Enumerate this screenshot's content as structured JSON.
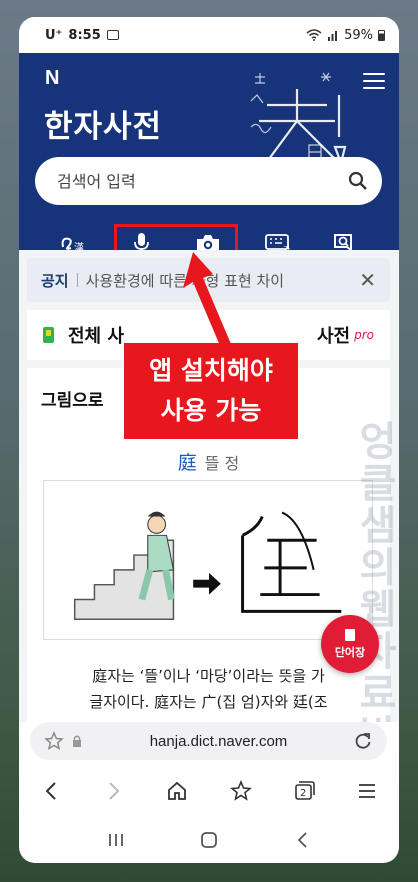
{
  "status_bar": {
    "carrier": "U⁺",
    "time": "8:55",
    "battery": "59%"
  },
  "header": {
    "logo": "N",
    "title": "한자사전",
    "search_placeholder": "검색어 입력"
  },
  "toolbar": {
    "icons": [
      "handwriting-hanja-icon",
      "microphone-icon",
      "camera-icon",
      "hanja-keyboard-icon",
      "dictionary-search-icon"
    ]
  },
  "notice": {
    "tag": "공지",
    "text": "사용환경에 따른 자형 표현 차이"
  },
  "dict_row": {
    "label_left": "전체 사",
    "label_right": "사전",
    "pro": "pro"
  },
  "card": {
    "title": "그림으로",
    "hanja": "庭",
    "reading": "뜰 정",
    "description_line1": "庭자는 ‘뜰’이나 ‘마당’이라는 뜻을 가",
    "description_line2": "글자이다. 庭자는 广(집 엄)자와 廷(조"
  },
  "overlay": {
    "line1": "앱 설치해야",
    "line2": "사용 가능"
  },
  "watermark": "엉클샘의웹자료방",
  "fab": {
    "label": "단어장"
  },
  "browser": {
    "url": "hanja.dict.naver.com",
    "tab_count": "2"
  },
  "colors": {
    "header_bg": "#17347a",
    "accent_red": "#e8171d",
    "fab_red": "#e11c37"
  }
}
